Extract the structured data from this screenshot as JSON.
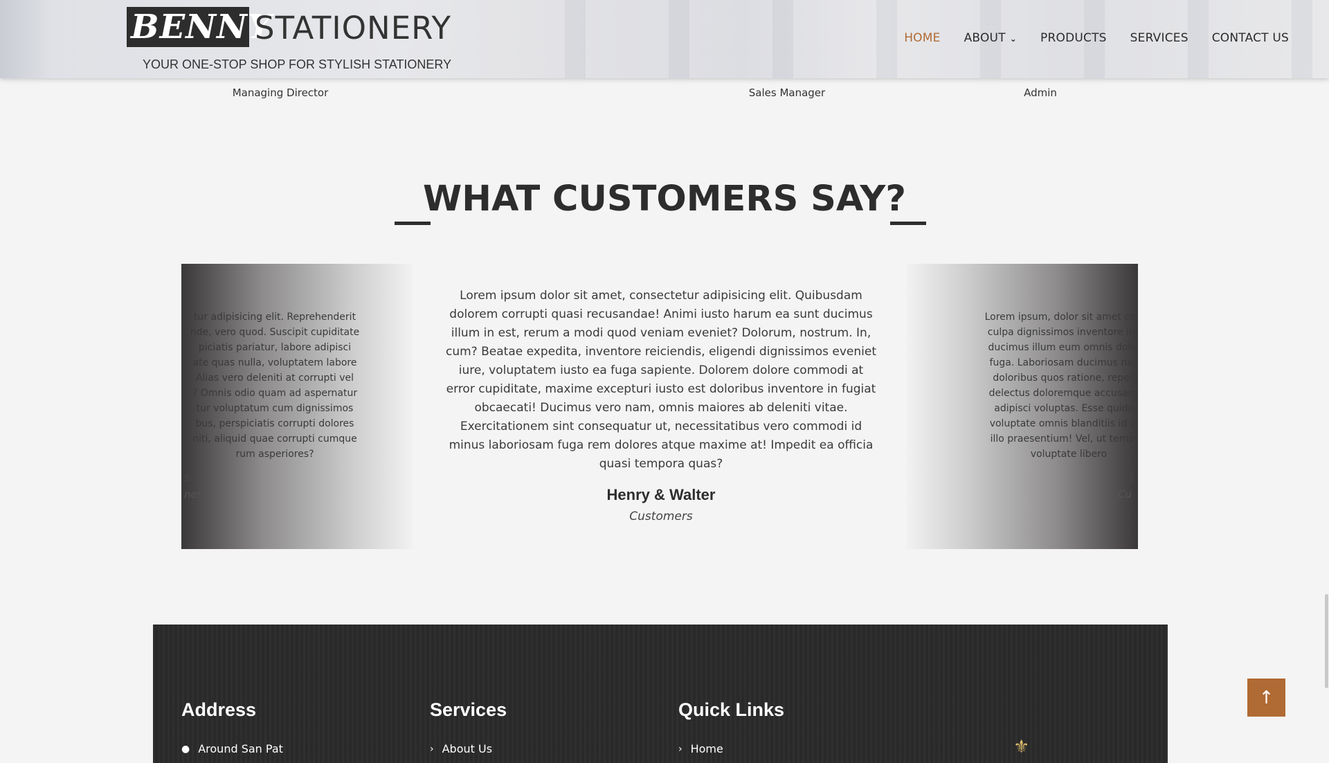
{
  "header": {
    "logo_primary": "BENNY",
    "logo_secondary": "STATIONERY",
    "tagline": "YOUR ONE-STOP SHOP FOR STYLISH STATIONERY",
    "nav": [
      {
        "label": "HOME",
        "active": true
      },
      {
        "label": "ABOUT",
        "has_dropdown": true
      },
      {
        "label": "PRODUCTS"
      },
      {
        "label": "SERVICES"
      },
      {
        "label": "CONTACT US"
      }
    ],
    "active_color": "#b06a33"
  },
  "team": {
    "roles": [
      "Managing Director",
      "Sales Manager",
      "Admin"
    ]
  },
  "testimonials": {
    "title": "WHAT CUSTOMERS SAY?",
    "left_card": {
      "text": "tur adipisicing elit. Reprehenderit\nnde, vero quod. Suscipit cupiditate\npiciatis pariatur, labore adipisci\nate quas nulla, voluptatem labore\nAlias vero deleniti at corrupti vel\n? Omnis odio quam ad aspernatur\ntur voluptatum cum dignissimos\nbus, perspiciatis corrupti dolores\nniti, aliquid quae corrupti cumque\nrum asperiores?",
      "name": "s",
      "role": "ner"
    },
    "center": {
      "text": "Lorem ipsum dolor sit amet, consectetur adipisicing elit. Quibusdam dolorem corrupti quasi recusandae! Animi iusto harum ea sunt ducimus illum in est, rerum a modi quod veniam eveniet? Dolorum, nostrum. In, cum? Beatae expedita, inventore reiciendis, eligendi dignissimos eveniet iure, voluptatem iusto ea fuga sapiente. Dolorem dolore commodi at error cupiditate, maxime excepturi iusto est doloribus inventore in fugiat obcaecati! Ducimus vero nam, omnis maiores ab deleniti vitae. Exercitationem sint consequatur ut, necessitatibus vero commodi id minus laboriosam fuga rem dolores atque maxime at! Impedit ea officia quasi tempora quas?",
      "name": "Henry & Walter",
      "role": "Customers"
    },
    "right_card": {
      "text": "Lorem ipsum, dolor sit amet conse\nculpa dignissimos inventore iusto\nducimus illum eum omnis dolore,\nfuga. Laboriosam ducimus natus\ndoloribus quos ratione, repellat\ndelectus doloremque accusamus\nadipisci voluptas. Esse quidem\nvoluptate omnis blanditiis id eve\nillo praesentium! Vel, ut tempori\nvoluptate libero",
      "name": "R",
      "role": "Cu"
    }
  },
  "footer": {
    "headings": [
      "Address",
      "Services",
      "Quick Links"
    ],
    "address_line": "Around San Pat",
    "services_link": "About Us",
    "quick_link": "Home"
  },
  "icons": {
    "dropdown": "chevron-down-icon",
    "location": "map-pin-icon",
    "link_arrow": "chevron-right-icon",
    "back_to_top": "arrow-up-icon"
  }
}
